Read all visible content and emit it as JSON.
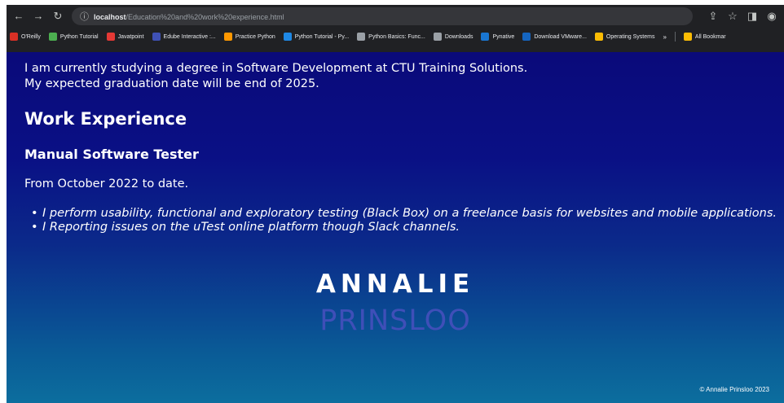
{
  "browser": {
    "url_host": "localhost",
    "url_path": "/Education%20and%20work%20experience.html",
    "bookmarks": [
      {
        "label": "O'Reilly",
        "color": "#d93025"
      },
      {
        "label": "Python Tutorial",
        "color": "#4caf50"
      },
      {
        "label": "Javatpoint",
        "color": "#e53935"
      },
      {
        "label": "Edube Interactive :...",
        "color": "#3f51b5"
      },
      {
        "label": "Practice Python",
        "color": "#ff9800"
      },
      {
        "label": "Python Tutorial - Py...",
        "color": "#1e88e5"
      },
      {
        "label": "Python Basics: Func...",
        "color": "#9aa0a6"
      },
      {
        "label": "Downloads",
        "color": "#9aa0a6"
      },
      {
        "label": "Pynative",
        "color": "#1976d2"
      },
      {
        "label": "Download VMware...",
        "color": "#1565c0"
      },
      {
        "label": "Operating Systems",
        "color": "#fbbc04"
      }
    ],
    "more_label": "»",
    "all_bookmarks_label": "All Bookmar"
  },
  "page": {
    "intro_line1": "I am currently studying a degree in Software Development at CTU Training Solutions.",
    "intro_line2": "My expected graduation date will be end of 2025.",
    "heading": "Work Experience",
    "job_title": "Manual Software Tester",
    "period": "From October 2022 to date.",
    "duties": [
      "I perform usability, functional and exploratory testing (Black Box) on a freelance basis for websites and mobile applications.",
      "I Reporting issues on the uTest online platform though Slack channels."
    ],
    "name_first": "ANNALIE",
    "name_last": "PRINSLOO",
    "footer": "© Annalie Prinsloo 2023"
  }
}
